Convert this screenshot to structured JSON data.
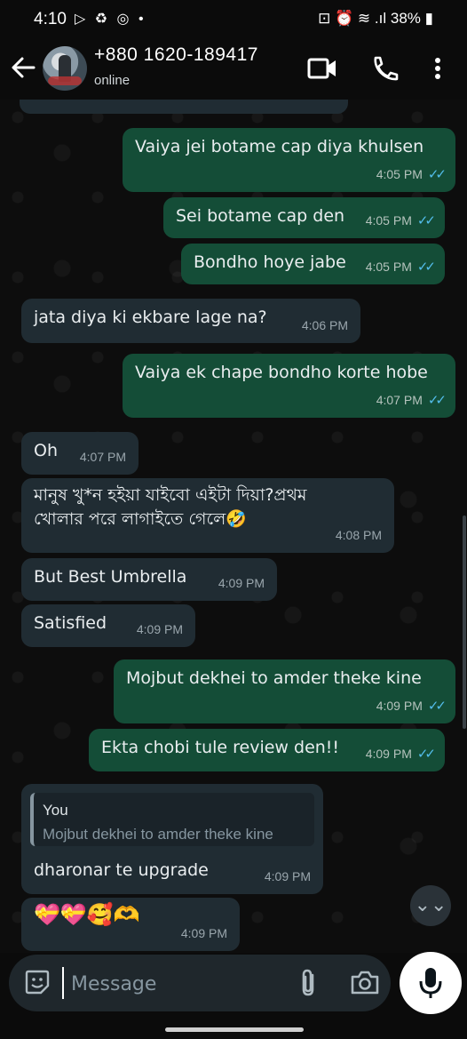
{
  "status_bar": {
    "time": "4:10",
    "left_icons": "▷ ♻ ◎ •",
    "battery": "38%",
    "right_icons": "⊡ ⏰ ≋ .ıl"
  },
  "header": {
    "contact_name": "+880 1620-189417",
    "contact_status": "online"
  },
  "messages": [
    {
      "dir": "out",
      "text": "Vaiya jei botame cap diya khulsen",
      "time": "4:05 PM",
      "ticks": "✓✓"
    },
    {
      "dir": "out",
      "text": "Sei botame cap den",
      "time": "4:05 PM",
      "ticks": "✓✓"
    },
    {
      "dir": "out",
      "text": "Bondho hoye jabe",
      "time": "4:05 PM",
      "ticks": "✓✓"
    },
    {
      "dir": "in",
      "text": "jata diya ki ekbare lage na?",
      "time": "4:06 PM"
    },
    {
      "dir": "out",
      "text": "Vaiya ek chape bondho korte hobe",
      "time": "4:07 PM",
      "ticks": "✓✓"
    },
    {
      "dir": "in",
      "text": "Oh",
      "time": "4:07 PM"
    },
    {
      "dir": "in",
      "line1": "মানুষ খু*ন হইয়া যাইবো এইটা দিয়া?প্রথম",
      "line2": "খোলার পরে লাগাইতে গেলে🤣",
      "time": "4:08 PM"
    },
    {
      "dir": "in",
      "text": "But Best Umbrella",
      "time": "4:09 PM"
    },
    {
      "dir": "in",
      "text": "Satisfied",
      "time": "4:09 PM"
    },
    {
      "dir": "out",
      "text": "Mojbut dekhei to amder theke kine",
      "time": "4:09 PM",
      "ticks": "✓✓"
    },
    {
      "dir": "out",
      "text": "Ekta chobi tule review den!!",
      "time": "4:09 PM",
      "ticks": "✓✓"
    },
    {
      "dir": "in",
      "quote_author": "You",
      "quote_text": "Mojbut dekhei to amder theke kine",
      "text": "dharonar te upgrade",
      "time": "4:09 PM"
    },
    {
      "dir": "in",
      "text": "💝💝🥰🫶",
      "time": "4:09 PM"
    }
  ],
  "input": {
    "placeholder": "Message"
  },
  "scroll_button": "⌄⌄",
  "colors": {
    "outgoing": "#144d37",
    "incoming": "#202c33",
    "tick": "#53bdeb"
  }
}
